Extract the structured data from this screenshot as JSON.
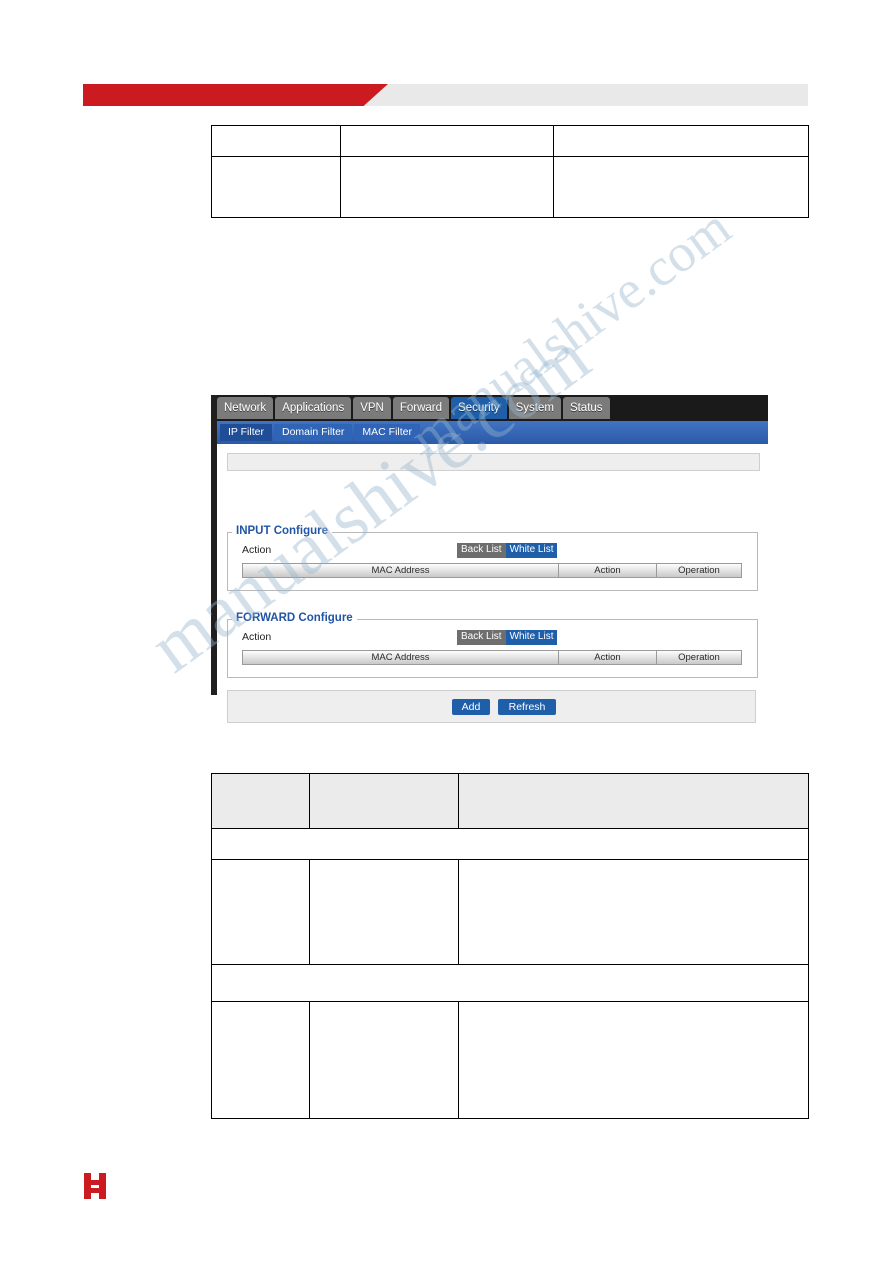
{
  "page": {
    "header_band_color": "#cc1b20",
    "header_band_bg": "#e9e9e9"
  },
  "watermark": {
    "line1": "manualshive.com",
    "line2": ""
  },
  "table_top": {
    "rows": [
      [
        "",
        "",
        ""
      ],
      [
        "",
        "",
        ""
      ]
    ]
  },
  "table_bottom": {
    "rows": [
      [
        "",
        "",
        ""
      ],
      [
        "",
        "",
        ""
      ],
      [
        "",
        "",
        ""
      ],
      [
        "",
        "",
        ""
      ],
      [
        "",
        "",
        ""
      ]
    ]
  },
  "router_ui": {
    "nav_tabs": [
      {
        "label": "Network",
        "active": false
      },
      {
        "label": "Applications",
        "active": false
      },
      {
        "label": "VPN",
        "active": false
      },
      {
        "label": "Forward",
        "active": false
      },
      {
        "label": "Security",
        "active": true
      },
      {
        "label": "System",
        "active": false
      },
      {
        "label": "Status",
        "active": false
      }
    ],
    "sub_tabs": [
      {
        "label": "IP Filter",
        "active": true
      },
      {
        "label": "Domain Filter",
        "active": false
      },
      {
        "label": "MAC Filter",
        "active": false
      }
    ],
    "input_section": {
      "title": "INPUT Configure",
      "action_label": "Action",
      "black_list": "Back List",
      "white_list": "White List",
      "columns": [
        "MAC Address",
        "Action",
        "Operation"
      ]
    },
    "forward_section": {
      "title": "FORWARD Configure",
      "action_label": "Action",
      "black_list": "Back List",
      "white_list": "White List",
      "columns": [
        "MAC Address",
        "Action",
        "Operation"
      ]
    },
    "buttons": {
      "add": "Add",
      "refresh": "Refresh"
    },
    "colors": {
      "accent_blue": "#1f5fa9",
      "nav_bg": "#1a1a1a",
      "subbar_bg": "#2f63b5",
      "tab_grey": "#7b7b7b"
    }
  }
}
